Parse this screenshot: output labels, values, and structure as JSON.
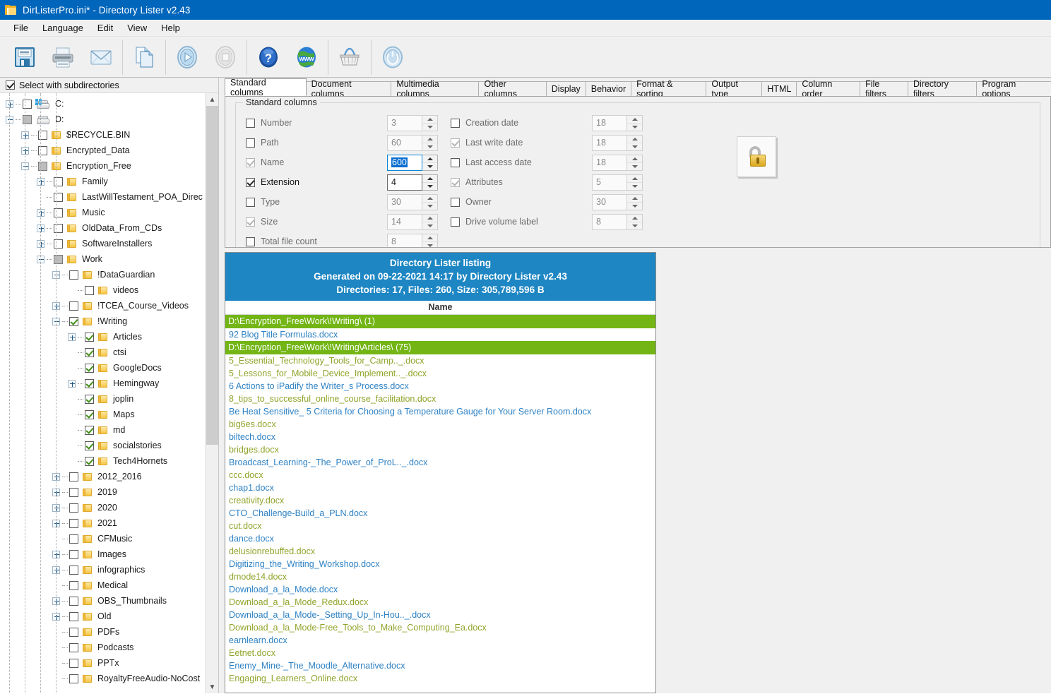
{
  "window": {
    "title": "DirListerPro.ini* - Directory Lister  v2.43",
    "app_icon": "folder-icon",
    "titlebar_color": "#0066bb"
  },
  "menu": {
    "items": [
      "File",
      "Language",
      "Edit",
      "View",
      "Help"
    ]
  },
  "toolbar": {
    "buttons": [
      {
        "name": "save-icon",
        "title": "Save"
      },
      {
        "name": "print-icon",
        "title": "Print"
      },
      {
        "name": "email-icon",
        "title": "Email"
      },
      {
        "name": "copy-icon",
        "title": "Copy"
      },
      {
        "name": "run-icon",
        "title": "Run"
      },
      {
        "name": "stop-icon",
        "title": "Stop"
      },
      {
        "name": "help-icon",
        "title": "Help"
      },
      {
        "name": "web-icon",
        "title": "Website"
      },
      {
        "name": "basket-icon",
        "title": "Buy"
      },
      {
        "name": "power-icon",
        "title": "Exit"
      }
    ]
  },
  "tree": {
    "select_with_subdirectories_label": "Select with subdirectories",
    "select_with_subdirectories_checked": true,
    "nodes": [
      {
        "label": "C:",
        "indent": 0,
        "type": "drive-windows",
        "check": "unchecked",
        "expander": "plus"
      },
      {
        "label": "D:",
        "indent": 0,
        "type": "drive",
        "check": "partial",
        "expander": "minus"
      },
      {
        "label": "$RECYCLE.BIN",
        "indent": 1,
        "type": "folder",
        "check": "unchecked",
        "expander": "plus"
      },
      {
        "label": "Encrypted_Data",
        "indent": 1,
        "type": "folder",
        "check": "unchecked",
        "expander": "plus"
      },
      {
        "label": "Encryption_Free",
        "indent": 1,
        "type": "folder",
        "check": "partial",
        "expander": "minus"
      },
      {
        "label": "Family",
        "indent": 2,
        "type": "folder",
        "check": "unchecked",
        "expander": "plus"
      },
      {
        "label": "LastWillTestament_POA_Direc",
        "indent": 2,
        "type": "folder",
        "check": "unchecked",
        "expander": "none"
      },
      {
        "label": "Music",
        "indent": 2,
        "type": "folder",
        "check": "unchecked",
        "expander": "plus"
      },
      {
        "label": "OldData_From_CDs",
        "indent": 2,
        "type": "folder",
        "check": "unchecked",
        "expander": "plus"
      },
      {
        "label": "SoftwareInstallers",
        "indent": 2,
        "type": "folder",
        "check": "unchecked",
        "expander": "plus"
      },
      {
        "label": "Work",
        "indent": 2,
        "type": "folder",
        "check": "partial",
        "expander": "minus"
      },
      {
        "label": "!DataGuardian",
        "indent": 3,
        "type": "folder",
        "check": "unchecked",
        "expander": "minus"
      },
      {
        "label": "videos",
        "indent": 4,
        "type": "folder",
        "check": "unchecked",
        "expander": "none"
      },
      {
        "label": "!TCEA_Course_Videos",
        "indent": 3,
        "type": "folder",
        "check": "unchecked",
        "expander": "plus"
      },
      {
        "label": "!Writing",
        "indent": 3,
        "type": "folder",
        "check": "checked",
        "expander": "minus"
      },
      {
        "label": "Articles",
        "indent": 4,
        "type": "folder",
        "check": "checked",
        "expander": "plus"
      },
      {
        "label": "ctsi",
        "indent": 4,
        "type": "folder",
        "check": "checked",
        "expander": "none"
      },
      {
        "label": "GoogleDocs",
        "indent": 4,
        "type": "folder",
        "check": "checked",
        "expander": "none"
      },
      {
        "label": "Hemingway",
        "indent": 4,
        "type": "folder",
        "check": "checked",
        "expander": "plus"
      },
      {
        "label": "joplin",
        "indent": 4,
        "type": "folder",
        "check": "checked",
        "expander": "none"
      },
      {
        "label": "Maps",
        "indent": 4,
        "type": "folder",
        "check": "checked",
        "expander": "none"
      },
      {
        "label": "md",
        "indent": 4,
        "type": "folder",
        "check": "checked",
        "expander": "none"
      },
      {
        "label": "socialstories",
        "indent": 4,
        "type": "folder",
        "check": "checked",
        "expander": "none"
      },
      {
        "label": "Tech4Hornets",
        "indent": 4,
        "type": "folder",
        "check": "checked",
        "expander": "none"
      },
      {
        "label": "2012_2016",
        "indent": 3,
        "type": "folder",
        "check": "unchecked",
        "expander": "plus"
      },
      {
        "label": "2019",
        "indent": 3,
        "type": "folder",
        "check": "unchecked",
        "expander": "plus"
      },
      {
        "label": "2020",
        "indent": 3,
        "type": "folder",
        "check": "unchecked",
        "expander": "plus"
      },
      {
        "label": "2021",
        "indent": 3,
        "type": "folder",
        "check": "unchecked",
        "expander": "plus"
      },
      {
        "label": "CFMusic",
        "indent": 3,
        "type": "folder",
        "check": "unchecked",
        "expander": "none"
      },
      {
        "label": "Images",
        "indent": 3,
        "type": "folder",
        "check": "unchecked",
        "expander": "plus"
      },
      {
        "label": "infographics",
        "indent": 3,
        "type": "folder",
        "check": "unchecked",
        "expander": "plus"
      },
      {
        "label": "Medical",
        "indent": 3,
        "type": "folder",
        "check": "unchecked",
        "expander": "none"
      },
      {
        "label": "OBS_Thumbnails",
        "indent": 3,
        "type": "folder",
        "check": "unchecked",
        "expander": "plus"
      },
      {
        "label": "Old",
        "indent": 3,
        "type": "folder",
        "check": "unchecked",
        "expander": "plus"
      },
      {
        "label": "PDFs",
        "indent": 3,
        "type": "folder",
        "check": "unchecked",
        "expander": "none"
      },
      {
        "label": "Podcasts",
        "indent": 3,
        "type": "folder",
        "check": "unchecked",
        "expander": "none"
      },
      {
        "label": "PPTx",
        "indent": 3,
        "type": "folder",
        "check": "unchecked",
        "expander": "none"
      },
      {
        "label": "RoyaltyFreeAudio-NoCost",
        "indent": 3,
        "type": "folder",
        "check": "unchecked",
        "expander": "none"
      }
    ]
  },
  "tabs": [
    {
      "label": "Standard columns",
      "active": true
    },
    {
      "label": "Document columns",
      "active": false
    },
    {
      "label": "Multimedia columns",
      "active": false
    },
    {
      "label": "Other columns",
      "active": false
    },
    {
      "label": "Display",
      "active": false
    },
    {
      "label": "Behavior",
      "active": false
    },
    {
      "label": "Format & sorting",
      "active": false
    },
    {
      "label": "Output type",
      "active": false
    },
    {
      "label": "HTML",
      "active": false
    },
    {
      "label": "Column order",
      "active": false
    },
    {
      "label": "File filters",
      "active": false
    },
    {
      "label": "Directory filters",
      "active": false
    },
    {
      "label": "Program options",
      "active": false
    }
  ],
  "standard_columns": {
    "group_label": "Standard columns",
    "left": [
      {
        "label": "Number",
        "check": "unchecked",
        "value": "3",
        "enabled": false,
        "focused": false
      },
      {
        "label": "Path",
        "check": "unchecked",
        "value": "60",
        "enabled": false,
        "focused": false
      },
      {
        "label": "Name",
        "check": "checked-dim",
        "value": "600",
        "enabled": false,
        "focused": true
      },
      {
        "label": "Extension",
        "check": "checked",
        "value": "4",
        "enabled": true,
        "focused": false
      },
      {
        "label": "Type",
        "check": "unchecked",
        "value": "30",
        "enabled": false,
        "focused": false
      },
      {
        "label": "Size",
        "check": "checked-dim",
        "value": "14",
        "enabled": false,
        "focused": false
      },
      {
        "label": "Total file count",
        "check": "unchecked",
        "value": "8",
        "enabled": false,
        "focused": false
      }
    ],
    "right": [
      {
        "label": "Creation date",
        "check": "unchecked",
        "value": "18",
        "enabled": false,
        "focused": false
      },
      {
        "label": "Last write date",
        "check": "checked-dim",
        "value": "18",
        "enabled": false,
        "focused": false
      },
      {
        "label": "Last access date",
        "check": "unchecked",
        "value": "18",
        "enabled": false,
        "focused": false
      },
      {
        "label": "Attributes",
        "check": "checked-dim",
        "value": "5",
        "enabled": false,
        "focused": false
      },
      {
        "label": "Owner",
        "check": "unchecked",
        "value": "30",
        "enabled": false,
        "focused": false
      },
      {
        "label": "Drive volume label",
        "check": "unchecked",
        "value": "8",
        "enabled": false,
        "focused": false
      }
    ],
    "lock_button_icon": "unlocked-padlock-icon"
  },
  "preview": {
    "header_line1": "Directory Lister listing",
    "header_line2": "Generated on 09-22-2021 14:17 by Directory Lister v2.43",
    "header_line3": "Directories: 17, Files: 260, Size: 305,789,596 B",
    "column_header": "Name",
    "header_bg": "#1d86c3",
    "dir_bg": "#72b514",
    "file_color_a": "#2e82c4",
    "file_color_b": "#8fa52a",
    "rows": [
      {
        "kind": "dir",
        "text": "D:\\Encryption_Free\\Work\\!Writing\\ (1)"
      },
      {
        "kind": "file",
        "text": "92 Blog Title Formulas.docx",
        "color": "a"
      },
      {
        "kind": "dir",
        "text": "D:\\Encryption_Free\\Work\\!Writing\\Articles\\ (75)"
      },
      {
        "kind": "file",
        "text": "5_Essential_Technology_Tools_for_Camp.._.docx",
        "color": "b"
      },
      {
        "kind": "file",
        "text": "5_Lessons_for_Mobile_Device_Implement.._.docx",
        "color": "b"
      },
      {
        "kind": "file",
        "text": "6 Actions to iPadify the Writer_s Process.docx",
        "color": "a"
      },
      {
        "kind": "file",
        "text": "8_tips_to_successful_online_course_facilitation.docx",
        "color": "b"
      },
      {
        "kind": "file",
        "text": "Be Heat Sensitive_ 5 Criteria for Choosing a Temperature Gauge for Your Server Room.docx",
        "color": "a"
      },
      {
        "kind": "file",
        "text": "big6es.docx",
        "color": "b"
      },
      {
        "kind": "file",
        "text": "biltech.docx",
        "color": "a"
      },
      {
        "kind": "file",
        "text": "bridges.docx",
        "color": "b"
      },
      {
        "kind": "file",
        "text": "Broadcast_Learning-_The_Power_of_ProL.._.docx",
        "color": "a"
      },
      {
        "kind": "file",
        "text": "ccc.docx",
        "color": "b"
      },
      {
        "kind": "file",
        "text": "chap1.docx",
        "color": "a"
      },
      {
        "kind": "file",
        "text": "creativity.docx",
        "color": "b"
      },
      {
        "kind": "file",
        "text": "CTO_Challenge-Build_a_PLN.docx",
        "color": "a"
      },
      {
        "kind": "file",
        "text": "cut.docx",
        "color": "b"
      },
      {
        "kind": "file",
        "text": "dance.docx",
        "color": "a"
      },
      {
        "kind": "file",
        "text": "delusionrebuffed.docx",
        "color": "b"
      },
      {
        "kind": "file",
        "text": "Digitizing_the_Writing_Workshop.docx",
        "color": "a"
      },
      {
        "kind": "file",
        "text": "dmode14.docx",
        "color": "b"
      },
      {
        "kind": "file",
        "text": "Download_a_la_Mode.docx",
        "color": "a"
      },
      {
        "kind": "file",
        "text": "Download_a_la_Mode_Redux.docx",
        "color": "b"
      },
      {
        "kind": "file",
        "text": "Download_a_la_Mode-_Setting_Up_In-Hou.._.docx",
        "color": "a"
      },
      {
        "kind": "file",
        "text": "Download_a_la_Mode-Free_Tools_to_Make_Computing_Ea.docx",
        "color": "b"
      },
      {
        "kind": "file",
        "text": "earnlearn.docx",
        "color": "a"
      },
      {
        "kind": "file",
        "text": "Eetnet.docx",
        "color": "b"
      },
      {
        "kind": "file",
        "text": "Enemy_Mine-_The_Moodle_Alternative.docx",
        "color": "a"
      },
      {
        "kind": "file",
        "text": "Engaging_Learners_Online.docx",
        "color": "b"
      }
    ]
  }
}
